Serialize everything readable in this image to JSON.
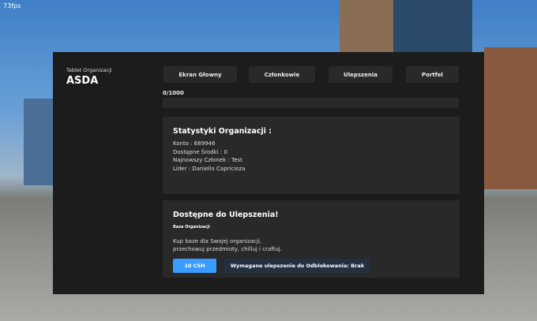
{
  "fps": "73fps",
  "header": {
    "subtitle": "Tablet Organizacji",
    "org_name": "ASDA"
  },
  "tabs": [
    {
      "label": "Ekran Głowny"
    },
    {
      "label": "Członkowie"
    },
    {
      "label": "Ulepszenia"
    },
    {
      "label": "Portfel"
    }
  ],
  "progress": {
    "label": "0/1000",
    "value": 0,
    "max": 1000
  },
  "stats": {
    "title": "Statystyki Organizacji :",
    "lines": [
      "Konto : 689946",
      "Dostępne Środki : 0",
      "Najnowszy Członek : Test",
      "Lider : Daniello Capricioza"
    ]
  },
  "upgrade": {
    "title": "Dostępne do Ulepszenia!",
    "name": "Baza Organizacji",
    "desc1": "Kup baze dla Swojej organizacji,",
    "desc2": "przechowuj przedmioty, chilluj i craftuj.",
    "price": "10 CSH",
    "requirement": "Wymagane ulepszenie do Odblokowania: Brak"
  },
  "colors": {
    "accent": "#3a9cff",
    "panel": "#1c1c1c",
    "card": "#292929"
  }
}
